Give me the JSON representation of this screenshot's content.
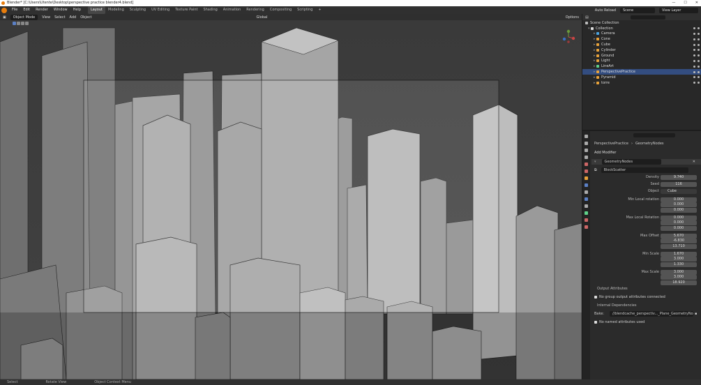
{
  "window": {
    "title": "Blender* [C:\\Users\\Utente\\Desktop\\perspective practice blender4.blend]"
  },
  "menus": [
    "File",
    "Edit",
    "Render",
    "Window",
    "Help"
  ],
  "workspaces": [
    "Layout",
    "Modeling",
    "Sculpting",
    "UV Editing",
    "Texture Paint",
    "Shading",
    "Animation",
    "Rendering",
    "Compositing",
    "Scripting"
  ],
  "active_workspace": "Layout",
  "topbar": {
    "auto_reload": "Auto Reload",
    "scene": "Scene",
    "view_layer": "View Layer"
  },
  "viewport": {
    "mode": "Object Mode",
    "view": "View",
    "select": "Select",
    "add": "Add",
    "object": "Object",
    "orientation": "Global",
    "options": "Options"
  },
  "outliner": {
    "root": "Scene Collection",
    "collection": "Collection",
    "items": [
      {
        "name": "Camera",
        "color": "#4aa3df"
      },
      {
        "name": "Cone",
        "color": "#e8a23a"
      },
      {
        "name": "Cube",
        "color": "#e8a23a"
      },
      {
        "name": "Cylinder",
        "color": "#e8a23a"
      },
      {
        "name": "Ground",
        "color": "#e8a23a"
      },
      {
        "name": "Light",
        "color": "#e8a23a"
      },
      {
        "name": "LineArt",
        "color": "#5fd18a"
      },
      {
        "name": "PerspectivePractice",
        "color": "#e8a23a",
        "selected": true
      },
      {
        "name": "Pyramid",
        "color": "#e8a23a"
      },
      {
        "name": "torre",
        "color": "#e8a23a"
      }
    ]
  },
  "properties": {
    "breadcrumb_object": "PerspectivePractice",
    "breadcrumb_modifier": "GeometryNodes",
    "add_modifier": "Add Modifier",
    "modifier_name": "GeometryNodes",
    "node_group": "BlockScatter",
    "density_label": "Density",
    "density": "9.740",
    "seed_label": "Seed",
    "seed": "116",
    "object_label": "Object",
    "object": "Cube",
    "min_rot_label": "Min Local rotation",
    "min_rot": [
      "0.000",
      "0.000",
      "0.000"
    ],
    "max_rot_label": "Max Local Rotation",
    "max_rot": [
      "0.000",
      "0.000",
      "0.000"
    ],
    "max_offset_label": "Max Offset",
    "max_offset": [
      "5.670",
      "-6.830",
      "13.710"
    ],
    "min_scale_label": "Min Scale",
    "min_scale": [
      "1.670",
      "3.000",
      "1.330"
    ],
    "max_scale_label": "Max Scale",
    "max_scale": [
      "3.000",
      "3.000",
      "18.920"
    ],
    "output_attributes": "Output Attributes",
    "no_group_output": "No group output attributes connected",
    "internal_dependencies": "Internal Dependencies",
    "bake_label": "Bake:",
    "bake_path": "//blendcache_perspectiv..._Plane_GeometryNodes",
    "no_named": "No named attributes used"
  },
  "status": {
    "select": "Select",
    "rotate": "Rotate View",
    "context": "Object Context Menu"
  }
}
